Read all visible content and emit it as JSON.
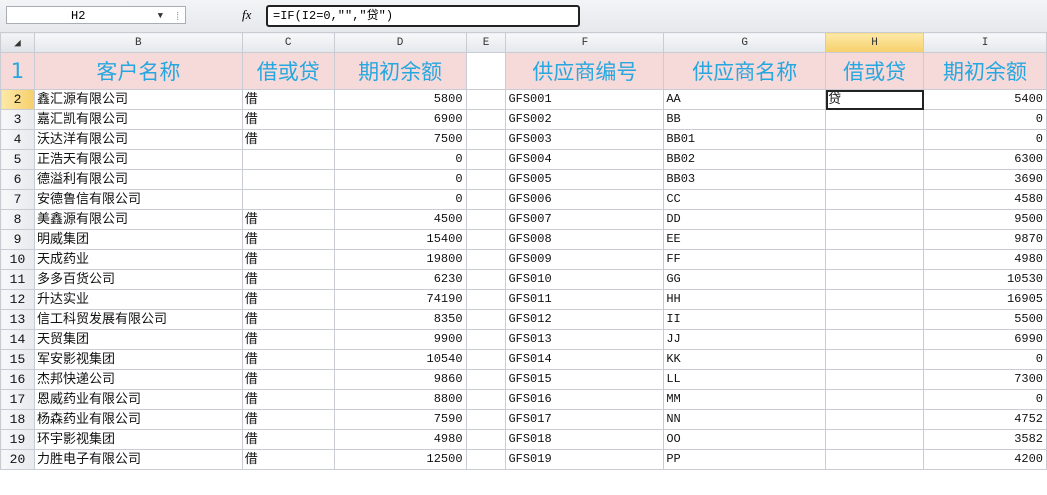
{
  "name_box": {
    "cell": "H2"
  },
  "formula_bar": {
    "fx": "fx",
    "formula": "=IF(I2=0,\"\",\"贷\")"
  },
  "col_headers": [
    "B",
    "C",
    "D",
    "E",
    "F",
    "G",
    "H",
    "I"
  ],
  "selected_column": "H",
  "selected_row": "2",
  "header_row": {
    "row": "1",
    "B": "客户名称",
    "C": "借或贷",
    "D": "期初余额",
    "E": "",
    "F": "供应商编号",
    "G": "供应商名称",
    "H": "借或贷",
    "I": "期初余额"
  },
  "rows": [
    {
      "row": "2",
      "B": "鑫汇源有限公司",
      "C": "借",
      "D": "5800",
      "F": "GFS001",
      "G": "AA",
      "H": "贷",
      "I": "5400"
    },
    {
      "row": "3",
      "B": "嘉汇凯有限公司",
      "C": "借",
      "D": "6900",
      "F": "GFS002",
      "G": "BB",
      "H": "",
      "I": "0"
    },
    {
      "row": "4",
      "B": "沃达洋有限公司",
      "C": "借",
      "D": "7500",
      "F": "GFS003",
      "G": "BB01",
      "H": "",
      "I": "0"
    },
    {
      "row": "5",
      "B": "正浩天有限公司",
      "C": "",
      "D": "0",
      "F": "GFS004",
      "G": "BB02",
      "H": "",
      "I": "6300"
    },
    {
      "row": "6",
      "B": "德溢利有限公司",
      "C": "",
      "D": "0",
      "F": "GFS005",
      "G": "BB03",
      "H": "",
      "I": "3690"
    },
    {
      "row": "7",
      "B": "安德鲁信有限公司",
      "C": "",
      "D": "0",
      "F": "GFS006",
      "G": "CC",
      "H": "",
      "I": "4580"
    },
    {
      "row": "8",
      "B": "美鑫源有限公司",
      "C": "借",
      "D": "4500",
      "F": "GFS007",
      "G": "DD",
      "H": "",
      "I": "9500"
    },
    {
      "row": "9",
      "B": "明威集团",
      "C": "借",
      "D": "15400",
      "F": "GFS008",
      "G": "EE",
      "H": "",
      "I": "9870"
    },
    {
      "row": "10",
      "B": "天成药业",
      "C": "借",
      "D": "19800",
      "F": "GFS009",
      "G": "FF",
      "H": "",
      "I": "4980"
    },
    {
      "row": "11",
      "B": "多多百货公司",
      "C": "借",
      "D": "6230",
      "F": "GFS010",
      "G": "GG",
      "H": "",
      "I": "10530"
    },
    {
      "row": "12",
      "B": "升达实业",
      "C": "借",
      "D": "74190",
      "F": "GFS011",
      "G": "HH",
      "H": "",
      "I": "16905"
    },
    {
      "row": "13",
      "B": "信工科贸发展有限公司",
      "C": "借",
      "D": "8350",
      "F": "GFS012",
      "G": "II",
      "H": "",
      "I": "5500"
    },
    {
      "row": "14",
      "B": "天贸集团",
      "C": "借",
      "D": "9900",
      "F": "GFS013",
      "G": "JJ",
      "H": "",
      "I": "6990"
    },
    {
      "row": "15",
      "B": "军安影视集团",
      "C": "借",
      "D": "10540",
      "F": "GFS014",
      "G": "KK",
      "H": "",
      "I": "0"
    },
    {
      "row": "16",
      "B": "杰邦快递公司",
      "C": "借",
      "D": "9860",
      "F": "GFS015",
      "G": "LL",
      "H": "",
      "I": "7300"
    },
    {
      "row": "17",
      "B": "恩威药业有限公司",
      "C": "借",
      "D": "8800",
      "F": "GFS016",
      "G": "MM",
      "H": "",
      "I": "0"
    },
    {
      "row": "18",
      "B": "杨森药业有限公司",
      "C": "借",
      "D": "7590",
      "F": "GFS017",
      "G": "NN",
      "H": "",
      "I": "4752"
    },
    {
      "row": "19",
      "B": "环宇影视集团",
      "C": "借",
      "D": "4980",
      "F": "GFS018",
      "G": "OO",
      "H": "",
      "I": "3582"
    },
    {
      "row": "20",
      "B": "力胜电子有限公司",
      "C": "借",
      "D": "12500",
      "F": "GFS019",
      "G": "PP",
      "H": "",
      "I": "4200"
    }
  ]
}
